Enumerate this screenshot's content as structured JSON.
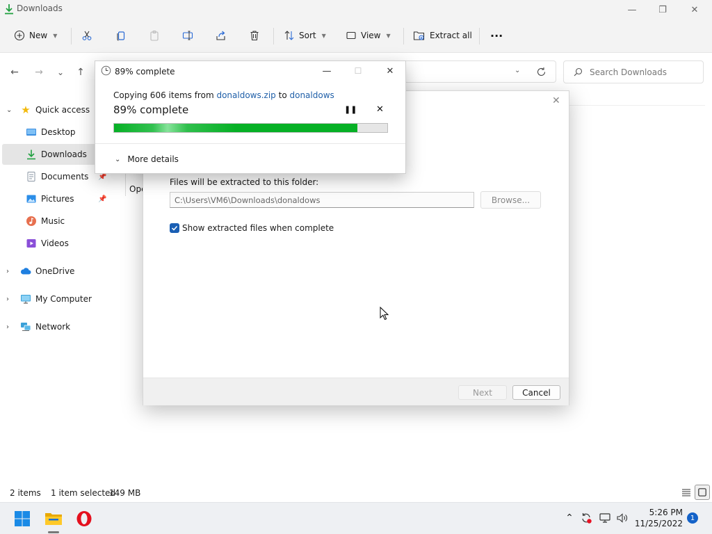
{
  "window": {
    "title": "Downloads",
    "minimize": "—",
    "restore": "❐",
    "close": "✕"
  },
  "toolbar": {
    "new_label": "New",
    "sort_label": "Sort",
    "view_label": "View",
    "extract_all_label": "Extract all",
    "more": "···"
  },
  "nav": {
    "back": "←",
    "forward": "→",
    "recent": "⌄",
    "up": "↑"
  },
  "search": {
    "placeholder": "Search Downloads"
  },
  "sidebar": {
    "items": [
      {
        "label": "Quick access"
      },
      {
        "label": "Desktop"
      },
      {
        "label": "Downloads"
      },
      {
        "label": "Documents"
      },
      {
        "label": "Pictures"
      },
      {
        "label": "Music"
      },
      {
        "label": "Videos"
      },
      {
        "label": "OneDrive"
      },
      {
        "label": "My Computer"
      },
      {
        "label": "Network"
      }
    ]
  },
  "file_fragment": "Ope",
  "status": {
    "items": "2 items",
    "selected": "1 item selected",
    "size": "149 MB"
  },
  "wizard": {
    "folder_label": "Files will be extracted to this folder:",
    "path_value": "C:\\Users\\VM6\\Downloads\\donaldows",
    "browse_label": "Browse...",
    "show_files_label": "Show extracted files when complete",
    "show_files_checked": true,
    "next_label": "Next",
    "cancel_label": "Cancel"
  },
  "progress": {
    "title": "89% complete",
    "copy_prefix": "Copying 606 items from ",
    "source": "donaldows.zip",
    "copy_to": " to ",
    "destination": "donaldows",
    "big_percent": "89% complete",
    "percent": 89,
    "more_details": "More details",
    "bar_color": "#06b025"
  },
  "taskbar": {
    "time": "5:26 PM",
    "date": "11/25/2022",
    "notifications": "1",
    "apps": [
      "windows-start-icon",
      "file-explorer-icon",
      "opera-browser-icon"
    ]
  }
}
